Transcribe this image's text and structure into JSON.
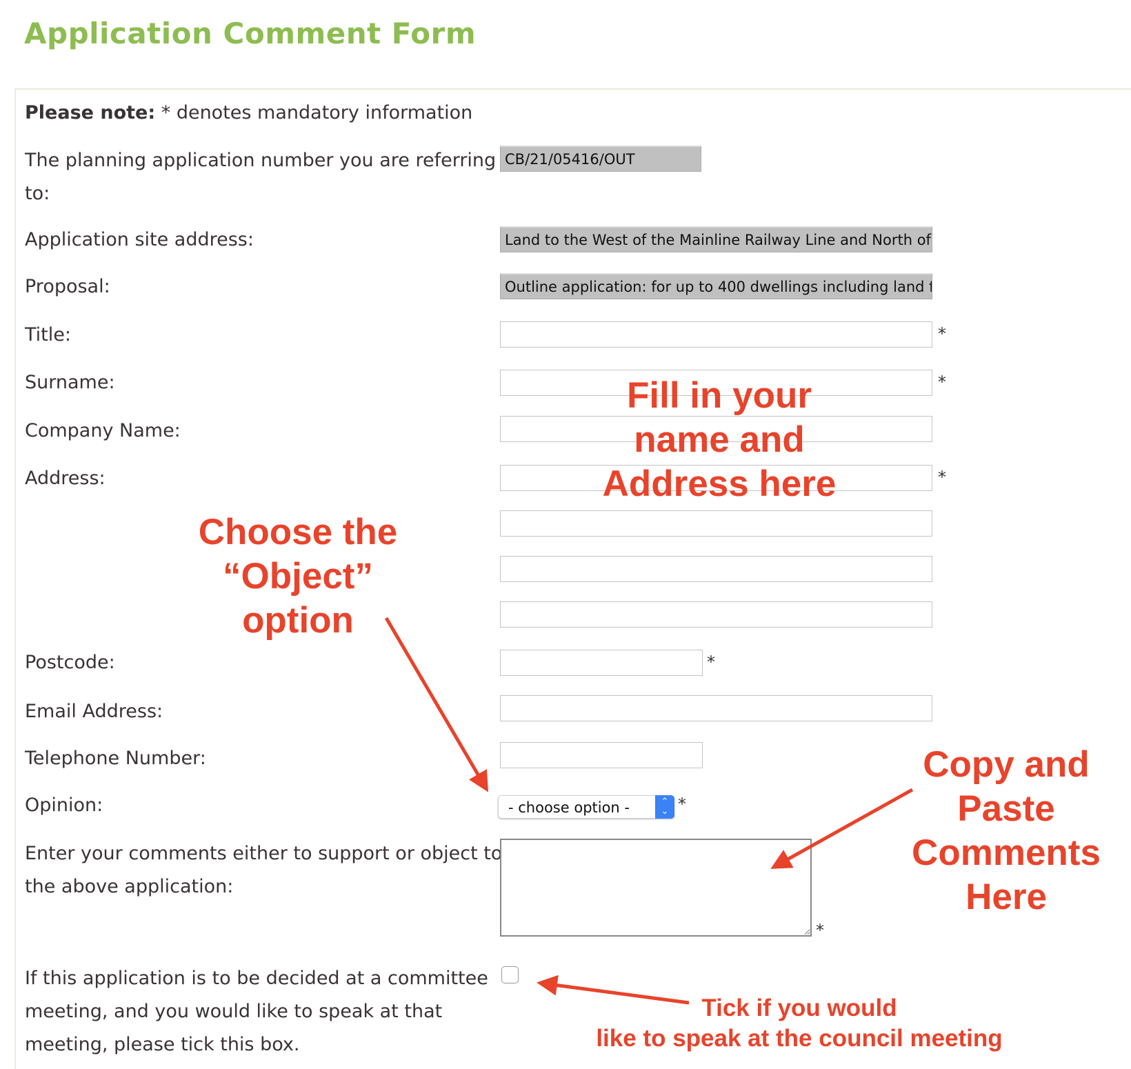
{
  "page": {
    "title": "Application Comment Form"
  },
  "note": {
    "bold": "Please note:",
    "text": " * denotes mandatory information"
  },
  "fields": {
    "app_number": {
      "label_line1": "The planning application number you are referring",
      "label_line2": "to:",
      "value": "CB/21/05416/OUT"
    },
    "site_address": {
      "label": "Application site address:",
      "value": "Land to the West of the Mainline Railway Line and North of"
    },
    "proposal": {
      "label": "Proposal:",
      "value": "Outline application: for up to 400 dwellings including land f"
    },
    "title": {
      "label": "Title:",
      "value": ""
    },
    "surname": {
      "label": "Surname:",
      "value": ""
    },
    "company": {
      "label": "Company Name:",
      "value": ""
    },
    "address": {
      "label": "Address:",
      "value": ""
    },
    "postcode": {
      "label": "Postcode:",
      "value": ""
    },
    "email": {
      "label": "Email Address:",
      "value": ""
    },
    "telephone": {
      "label": "Telephone Number:",
      "value": ""
    },
    "opinion": {
      "label": "Opinion:",
      "selected": "- choose option -"
    },
    "comments": {
      "label_line1": "Enter your comments either to support or object to",
      "label_line2": "the above application:",
      "value": ""
    },
    "speak": {
      "label_line1": "If this application is to be decided at a committee",
      "label_line2": "meeting, and you would like to speak at that",
      "label_line3": "meeting, please tick this box.",
      "checked": false
    }
  },
  "required_mark": "*",
  "annotations": {
    "fill": [
      "Fill in your",
      "name and",
      "Address here"
    ],
    "choose": [
      "Choose the",
      "“Object”",
      "option"
    ],
    "copy": [
      "Copy and",
      "Paste",
      "Comments",
      "Here"
    ],
    "tick": [
      "Tick if you would",
      "like to speak at the council meeting"
    ],
    "color": "#e8432b"
  },
  "colors": {
    "heading": "#8dbd50",
    "select_accent": "#3b82f6"
  }
}
